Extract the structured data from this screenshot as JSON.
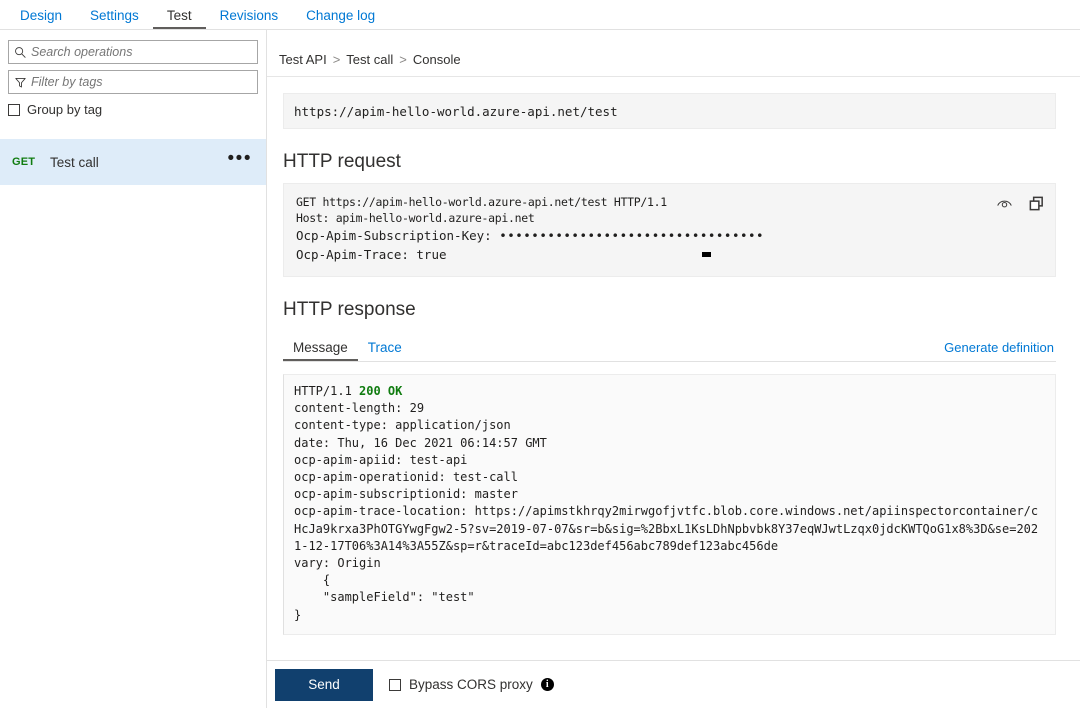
{
  "top_tabs": [
    {
      "label": "Design",
      "active": false
    },
    {
      "label": "Settings",
      "active": false
    },
    {
      "label": "Test",
      "active": true
    },
    {
      "label": "Revisions",
      "active": false
    },
    {
      "label": "Change log",
      "active": false
    }
  ],
  "sidebar": {
    "search_placeholder": "Search operations",
    "filter_placeholder": "Filter by tags",
    "group_by_tag_label": "Group by tag",
    "operations": [
      {
        "method": "GET",
        "name": "Test call",
        "more_label": "•••"
      }
    ]
  },
  "breadcrumb": {
    "items": [
      "Test API",
      "Test call",
      "Console"
    ],
    "separator": ">"
  },
  "url_bar": {
    "value": "https://apim-hello-world.azure-api.net/test"
  },
  "http_request": {
    "title": "HTTP request",
    "lines": [
      "GET https://apim-hello-world.azure-api.net/test HTTP/1.1",
      "Host: apim-hello-world.azure-api.net"
    ],
    "subscription_key_label": "Ocp-Apim-Subscription-Key: ",
    "subscription_key_masked": "•••••••••••••••••••••••••••••••••",
    "trace_line": "Ocp-Apim-Trace: true",
    "reveal_icon": "eye-icon",
    "copy_icon": "copy-icon"
  },
  "http_response": {
    "title": "HTTP response",
    "tabs": [
      {
        "label": "Message",
        "active": true
      },
      {
        "label": "Trace",
        "active": false
      }
    ],
    "generate_definition_label": "Generate definition",
    "status_prefix": "HTTP/1.1 ",
    "status_code": "200 OK",
    "headers": [
      "content-length: 29",
      "content-type: application/json",
      "date: Thu, 16 Dec 2021 06:14:57 GMT",
      "ocp-apim-apiid: test-api",
      "ocp-apim-operationid: test-call",
      "ocp-apim-subscriptionid: master"
    ],
    "trace_location": "ocp-apim-trace-location: https://apimstkhrqy2mirwgofjvtfc.blob.core.windows.net/apiinspectorcontainer/cHcJa9krxa3PhOTGYwgFgw2-5?sv=2019-07-07&sr=b&sig=%2BbxL1KsLDhNpbvbk8Y37eqWJwtLzqx0jdcKWTQoG1x8%3D&se=2021-12-17T06%3A14%3A55Z&sp=r&traceId=abc123def456abc789def123abc456de",
    "vary": "vary: Origin",
    "body": "    {\n    \"sampleField\": \"test\"\n}"
  },
  "footer": {
    "send_label": "Send",
    "bypass_cors_label": "Bypass CORS proxy",
    "info_icon_glyph": "i"
  }
}
